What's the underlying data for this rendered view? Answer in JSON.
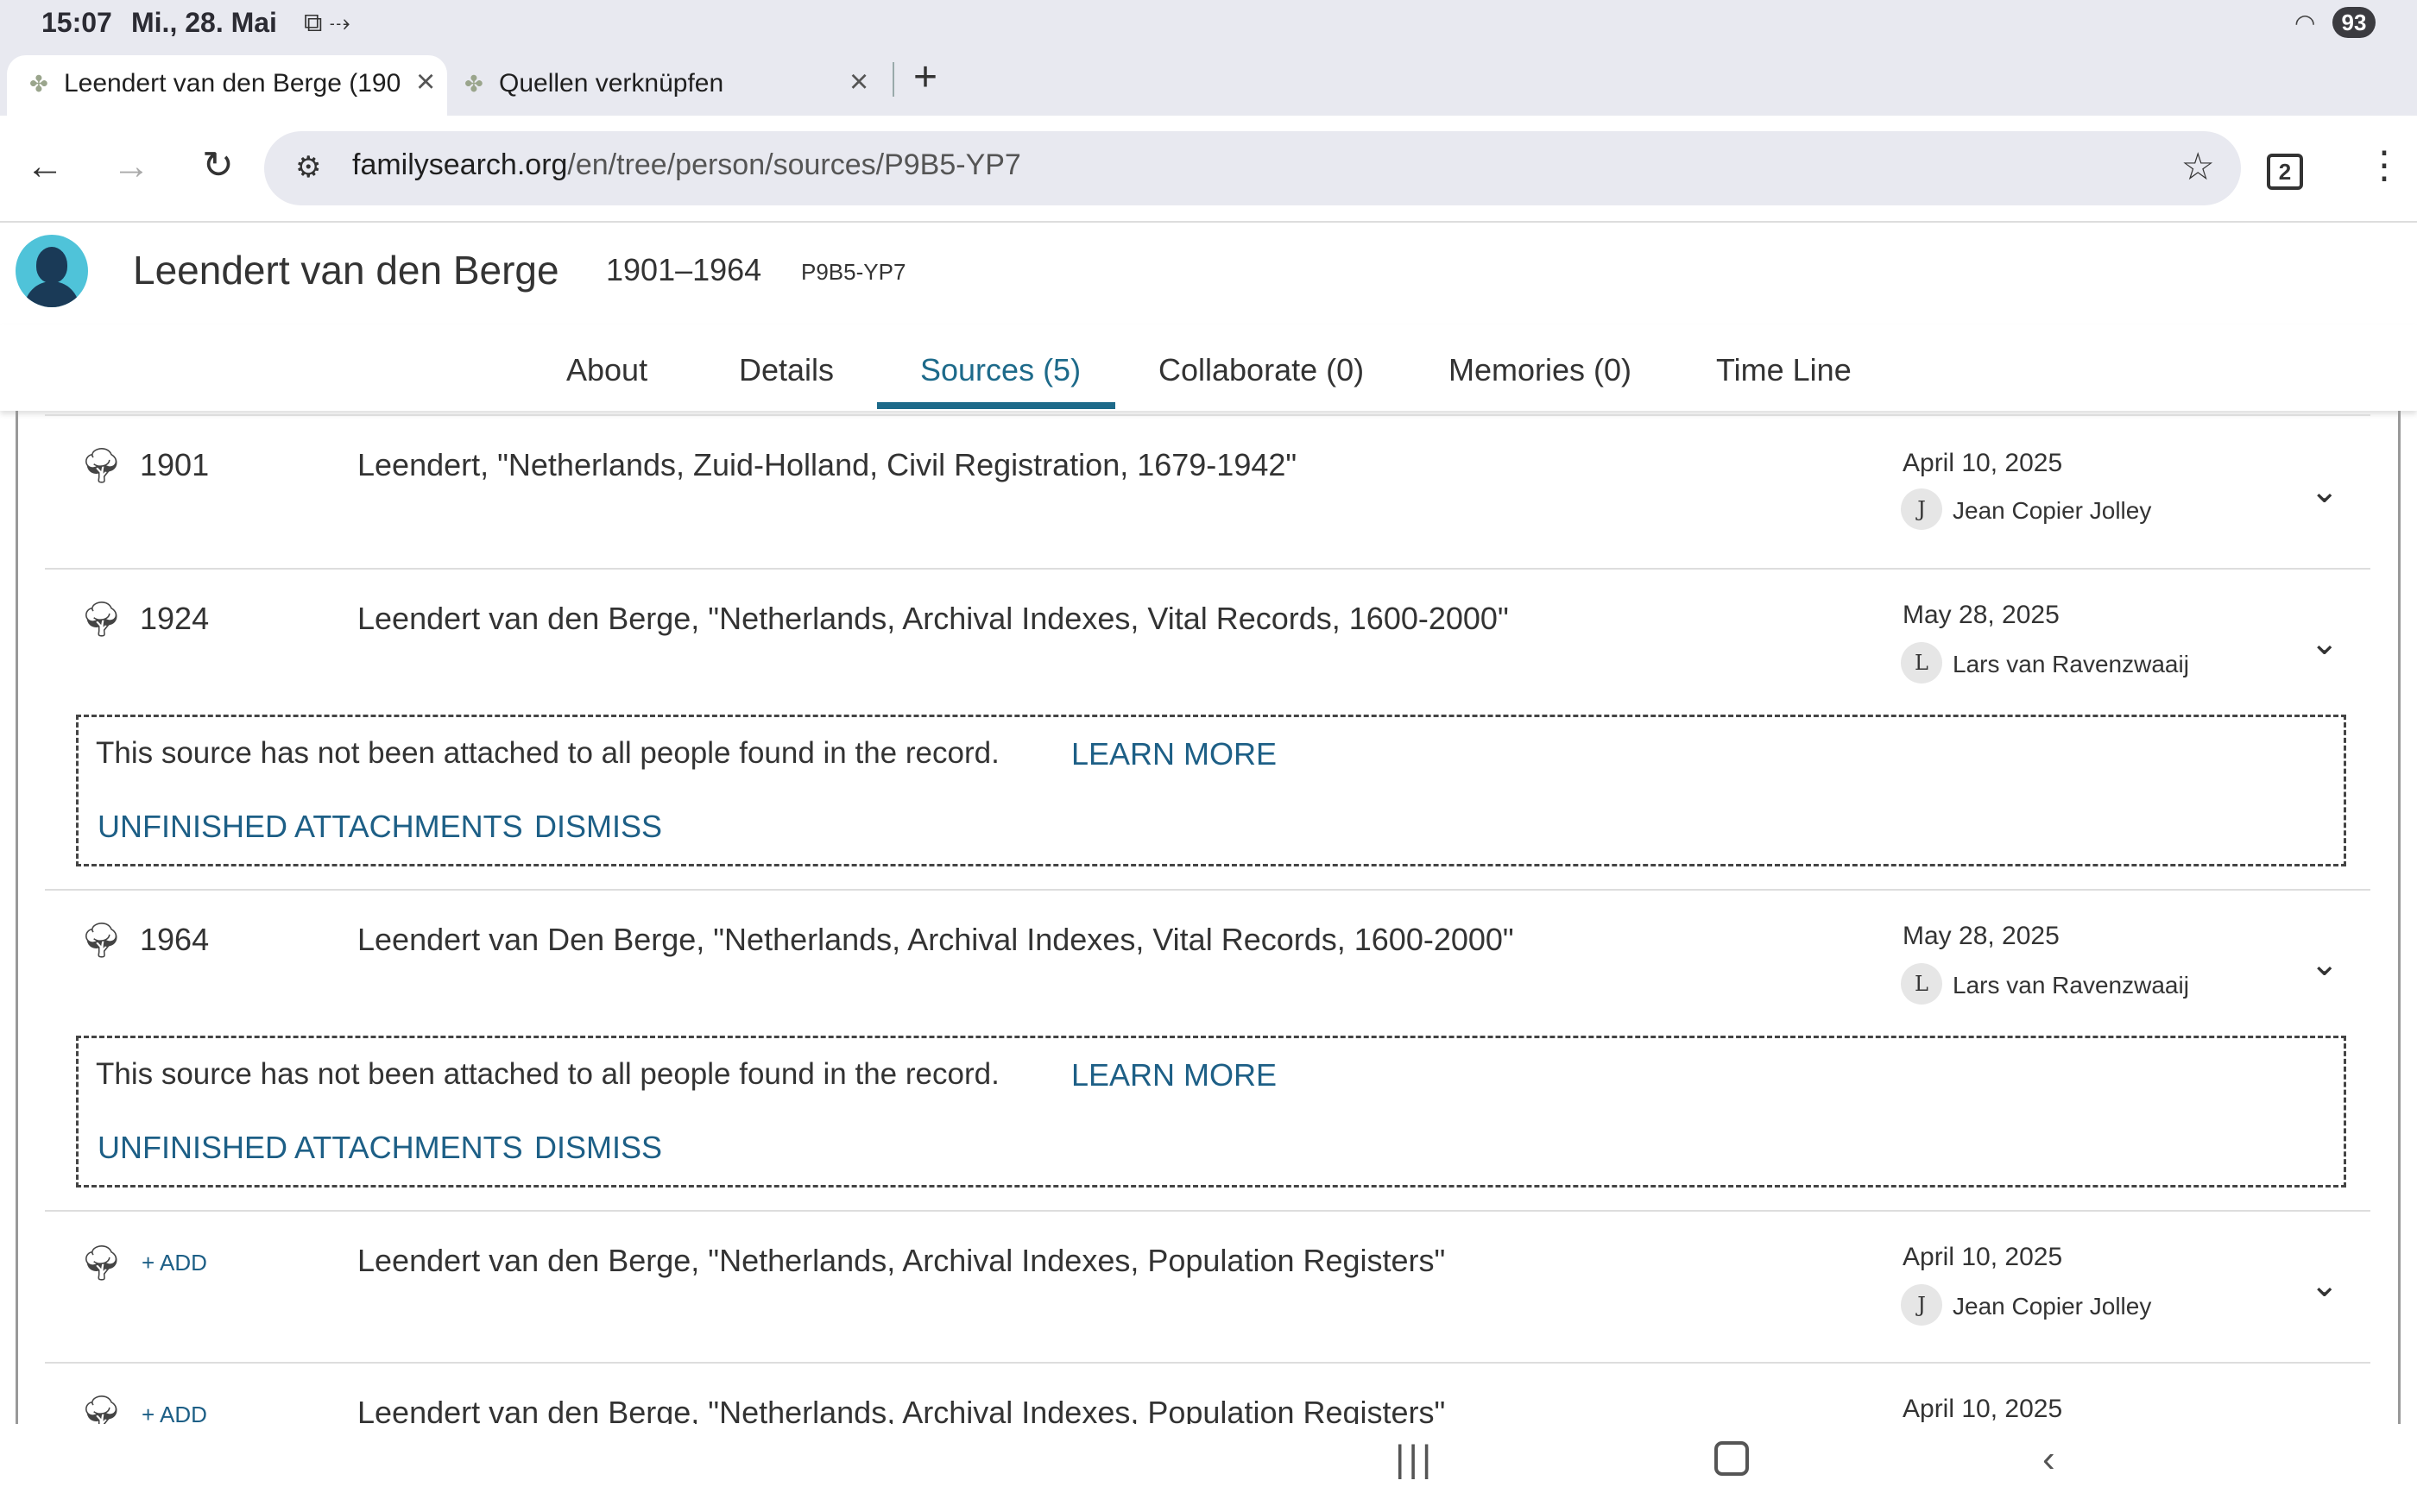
{
  "status_bar": {
    "time": "15:07",
    "date": "Mi., 28. Mai",
    "battery": "93"
  },
  "browser_tabs": [
    {
      "title": "Leendert van den Berge (190",
      "active": true
    },
    {
      "title": "Quellen verknüpfen",
      "active": false
    }
  ],
  "toolbar": {
    "url_host": "familysearch.org",
    "url_path": "/en/tree/person/sources/P9B5-YP7",
    "tab_count": "2"
  },
  "person": {
    "name": "Leendert van den Berge",
    "lifespan": "1901–1964",
    "pid": "P9B5-YP7"
  },
  "nav_tabs": [
    "About",
    "Details",
    "Sources (5)",
    "Collaborate (0)",
    "Memories (0)",
    "Time Line"
  ],
  "sources": [
    {
      "year": "1901",
      "title": "Leendert, \"Netherlands, Zuid-Holland, Civil Registration, 1679-1942\"",
      "date": "April 10, 2025",
      "initial": "J",
      "contributor": "Jean Copier Jolley"
    },
    {
      "year": "1924",
      "title": "Leendert van den Berge, \"Netherlands, Archival Indexes, Vital Records, 1600-2000\"",
      "date": "May 28, 2025",
      "initial": "L",
      "contributor": "Lars van Ravenzwaaij"
    },
    {
      "year": "1964",
      "title": "Leendert van Den Berge, \"Netherlands, Archival Indexes, Vital Records, 1600-2000\"",
      "date": "May 28, 2025",
      "initial": "L",
      "contributor": "Lars van Ravenzwaaij"
    },
    {
      "add": "+ ADD",
      "title": "Leendert van den Berge, \"Netherlands, Archival Indexes, Population Registers\"",
      "date": "April 10, 2025",
      "initial": "J",
      "contributor": "Jean Copier Jolley"
    },
    {
      "add": "+ ADD",
      "title": "Leendert van den Berge, \"Netherlands, Archival Indexes, Population Registers\"",
      "date": "April 10, 2025"
    }
  ],
  "notice": {
    "message": "This source has not been attached to all people found in the record.",
    "learn_more": "LEARN MORE",
    "unfinished": "UNFINISHED ATTACHMENTS",
    "dismiss": "DISMISS"
  },
  "icons": {
    "source_icon": "tree-icon",
    "chevron": "chevron-down-icon",
    "close": "close-icon"
  },
  "colors": {
    "link": "#1d5f86",
    "active_tab": "#1d6a8a"
  }
}
